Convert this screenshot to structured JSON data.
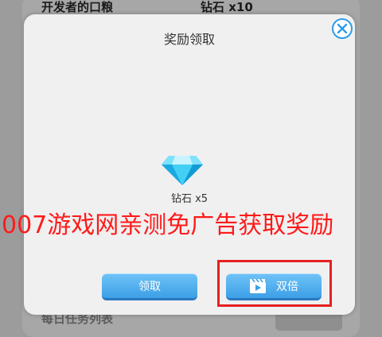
{
  "background": {
    "row_top": {
      "name": "开发者的口粮",
      "reward": "钻石  x10"
    },
    "row_bottom": {
      "name": "每日任务列表"
    }
  },
  "dialog": {
    "title": "奖励领取",
    "reward_text": "钻石  x5",
    "watermark": "007游戏网亲测免广告获取奖励",
    "claim_label": "领取",
    "double_label": "双倍",
    "icons": [
      "close-icon",
      "diamond-icon",
      "video-icon"
    ]
  },
  "colors": {
    "accent": "#3d9fe6",
    "highlight": "#e62020",
    "watermark": "#ff1a1a",
    "diamond": "#2fc4f0"
  }
}
